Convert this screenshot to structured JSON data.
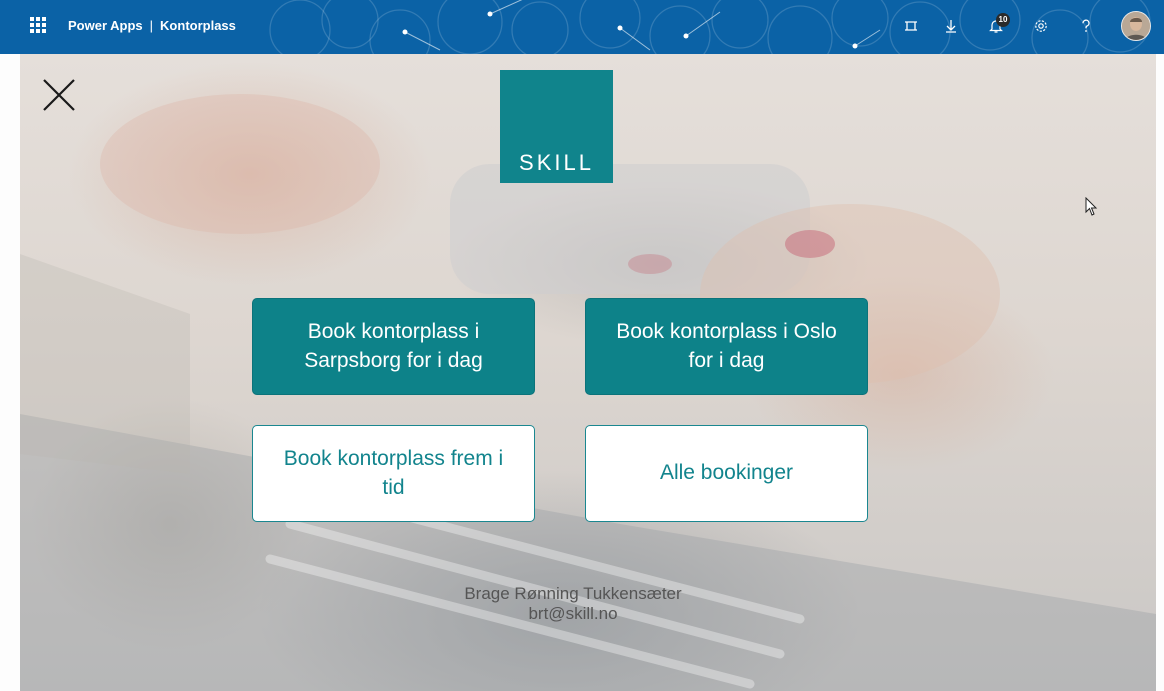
{
  "header": {
    "app_name": "Power Apps",
    "separator": "|",
    "environment": "Kontorplass",
    "notification_count": "10",
    "icons": [
      "waffle-icon",
      "fit-to-screen-icon",
      "download-icon",
      "notifications-icon",
      "settings-icon",
      "help-icon",
      "avatar"
    ],
    "background_color": "#0b62a6"
  },
  "app": {
    "close_icon": "close-icon",
    "logo_text": "SKILL",
    "logo_color": "#10848c",
    "buttons": {
      "sarpsborg_today": "Book kontorplass i Sarpsborg for i dag",
      "oslo_today": "Book kontorplass i Oslo for i dag",
      "book_future": "Book kontorplass frem i tid",
      "all_bookings": "Alle bookinger"
    },
    "button_primary_color": "#0d8289",
    "user": {
      "name": "Brage Rønning Tukkensæter",
      "email": "brt@skill.no"
    }
  }
}
